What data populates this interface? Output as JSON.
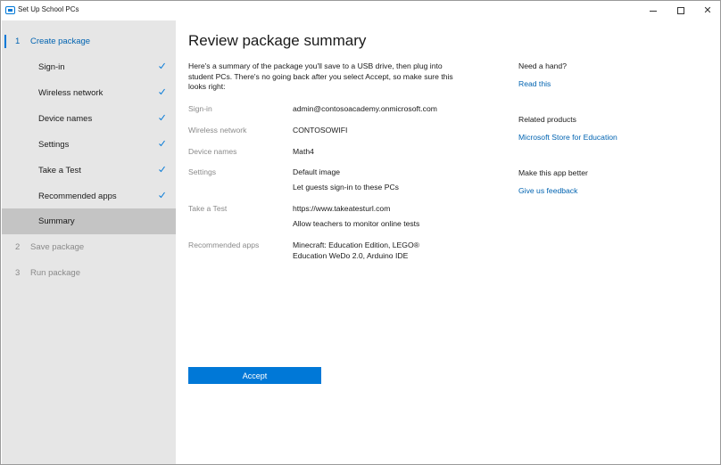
{
  "window": {
    "title": "Set Up School PCs",
    "minimize": "–",
    "maximize": "",
    "close": "✕"
  },
  "sidebar": {
    "steps": [
      {
        "num": "1",
        "label": "Create package",
        "state": "active"
      },
      {
        "num": "",
        "label": "Sign-in",
        "state": "done"
      },
      {
        "num": "",
        "label": "Wireless network",
        "state": "done"
      },
      {
        "num": "",
        "label": "Device names",
        "state": "done"
      },
      {
        "num": "",
        "label": "Settings",
        "state": "done"
      },
      {
        "num": "",
        "label": "Take a Test",
        "state": "done"
      },
      {
        "num": "",
        "label": "Recommended apps",
        "state": "done"
      },
      {
        "num": "",
        "label": "Summary",
        "state": "selected"
      },
      {
        "num": "2",
        "label": "Save package",
        "state": "disabled"
      },
      {
        "num": "3",
        "label": "Run package",
        "state": "disabled"
      }
    ],
    "check_icon": "checkmark-icon",
    "accent_color": "#0078d7"
  },
  "main": {
    "heading": "Review package summary",
    "intro": "Here's a summary of the package you'll save to a USB drive, then plug into student PCs. There's no going back after you select Accept, so make sure this looks right:",
    "fields": {
      "signin": {
        "label": "Sign-in",
        "value": "admin@contosoacademy.onmicrosoft.com"
      },
      "wireless": {
        "label": "Wireless network",
        "value": "CONTOSOWIFI"
      },
      "device": {
        "label": "Device names",
        "value": "Math4"
      },
      "settings": {
        "label": "Settings",
        "value1": "Default image",
        "value2": "Let guests sign-in to these PCs"
      },
      "test": {
        "label": "Take a Test",
        "value1": "https://www.takeatesturl.com",
        "value2": "Allow teachers to monitor online tests"
      },
      "apps": {
        "label": "Recommended apps",
        "value1": "Minecraft: Education Edition, LEGO®",
        "value2": "Education WeDo 2.0, Arduino IDE"
      }
    },
    "accept_label": "Accept"
  },
  "help": {
    "need_hand": "Need a hand?",
    "read_this": "Read this",
    "related": "Related products",
    "store": "Microsoft Store for Education",
    "better": "Make this app better",
    "feedback": "Give us feedback"
  }
}
